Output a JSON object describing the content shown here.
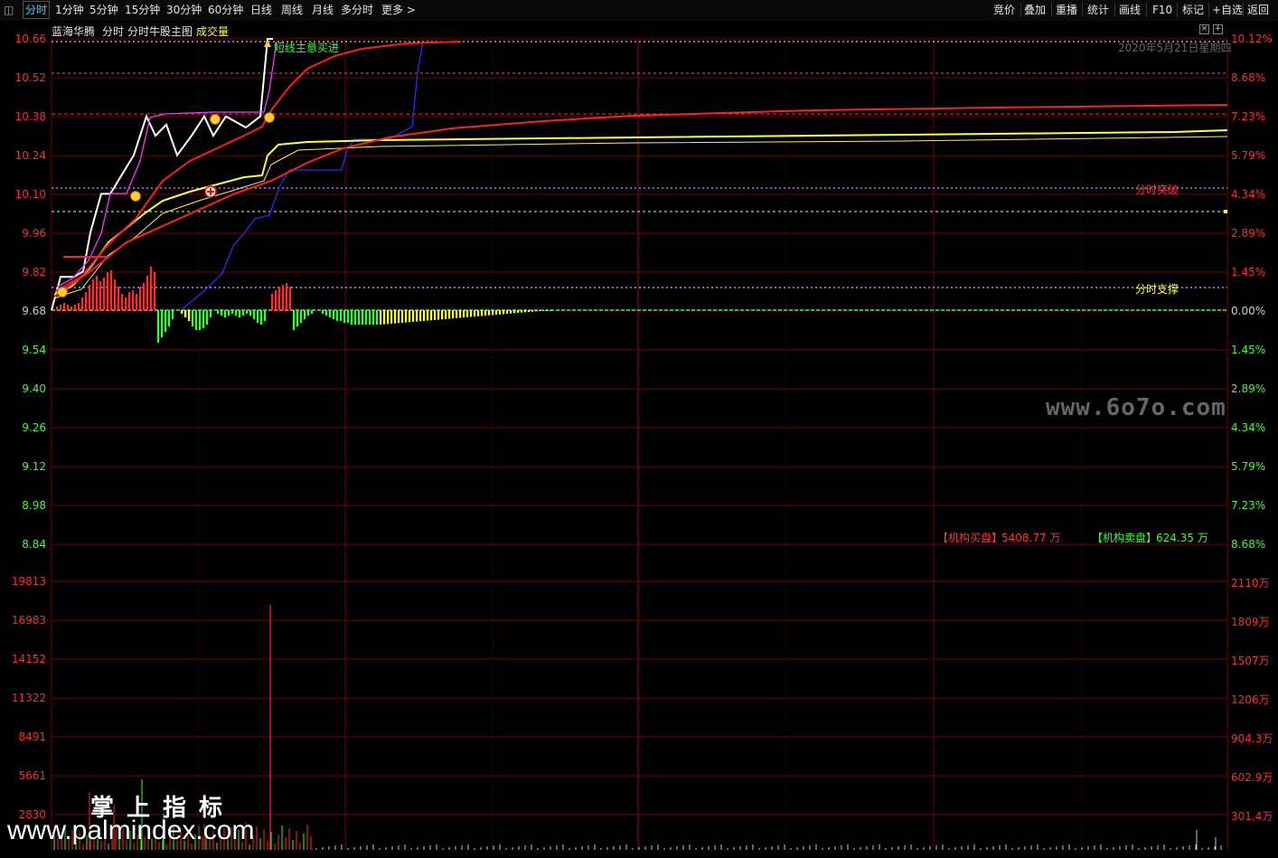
{
  "toolbar": {
    "tabs": [
      "分时",
      "1分钟",
      "5分钟",
      "15分钟",
      "30分钟",
      "60分钟",
      "日线",
      "周线",
      "月线",
      "多分时",
      "更多 >"
    ],
    "active_tab": "分时",
    "right_buttons": [
      "竞价",
      "叠加",
      "重播",
      "统计",
      "画线",
      "F10",
      "标记",
      "+自选",
      "返回"
    ]
  },
  "header": {
    "stock_name": "蓝海华腾",
    "view": "分时",
    "indicator_name": "分时牛股主图",
    "volume_label": "成交量",
    "date": "2020年5月21日星期四"
  },
  "annotations": {
    "buy_signal": "短线主意买进",
    "resistance": "分时突破",
    "support": "分时支撑",
    "inst_buy_label": "【机构买盘】",
    "inst_buy_value": "5408.77 万",
    "inst_sell_label": "【机构卖盘】",
    "inst_sell_value": "624.35 万"
  },
  "price_axis": {
    "left": [
      "10.66",
      "10.52",
      "10.38",
      "10.24",
      "10.10",
      "9.96",
      "9.82",
      "9.68",
      "9.54",
      "9.40",
      "9.26",
      "9.12",
      "8.98",
      "8.84"
    ],
    "right": [
      "10.12%",
      "8.68%",
      "7.23%",
      "5.79%",
      "4.34%",
      "2.89%",
      "1.45%",
      "0.00%",
      "1.45%",
      "2.89%",
      "4.34%",
      "5.79%",
      "7.23%",
      "8.68%"
    ]
  },
  "volume_axis": {
    "left": [
      "19813",
      "16983",
      "14152",
      "11322",
      "8491",
      "5661",
      "2830"
    ],
    "right": [
      "2110万",
      "1809万",
      "1507万",
      "1206万",
      "904.3万",
      "602.9万",
      "301.4万"
    ]
  },
  "watermarks": {
    "site": "www.6o7o.com",
    "palm_title": "掌上指标",
    "palm_url": "www.palmindex.com"
  },
  "colors": {
    "up": "#ff2a2a",
    "down": "#33ff33",
    "grid": "#7a0000",
    "price_line": "#ffffff",
    "avg_line": "#ffff33",
    "trend_line": "#ff2020",
    "aux_line": "#2a2aff",
    "magenta_line": "#ff33ff",
    "base_line": "#33ff33"
  },
  "chart_data": {
    "type": "line",
    "series": [
      {
        "name": "",
        "values": [
          9.68,
          9.8,
          9.8,
          9.82,
          9.96,
          10.1,
          10.1,
          10.24,
          10.38,
          10.31,
          10.35,
          10.24,
          10.31,
          10.38,
          10.31,
          10.38,
          10.34,
          10.38,
          10.66,
          10.66,
          10.66
        ]
      }
    ]
  }
}
